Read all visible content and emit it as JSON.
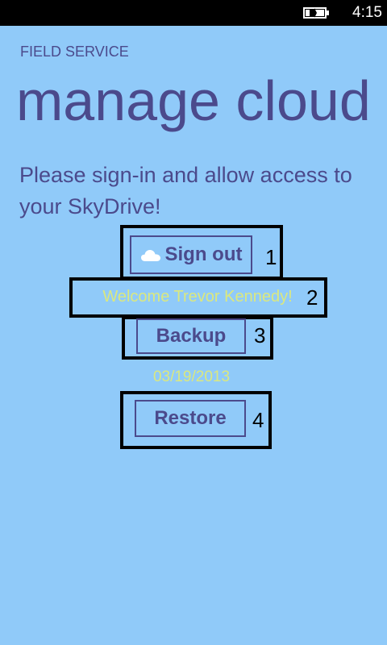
{
  "status_bar": {
    "time": "4:15",
    "battery_icon": "battery-charging-icon"
  },
  "header": {
    "app_name": "FIELD SERVICE",
    "title": "manage cloud"
  },
  "instructions": "Please sign-in and allow access to your SkyDrive!",
  "sign_in": {
    "icon": "cloud-icon",
    "label": "Sign out",
    "welcome": "Welcome Trevor Kennedy!"
  },
  "backup": {
    "label": "Backup",
    "last_date": "03/19/2013"
  },
  "restore": {
    "label": "Restore"
  },
  "annotations": [
    "1",
    "2",
    "3",
    "4"
  ],
  "colors": {
    "background": "#90caf9",
    "text": "#4b4a8c",
    "highlight_text": "#dbe87f",
    "status_bar": "#000000"
  }
}
